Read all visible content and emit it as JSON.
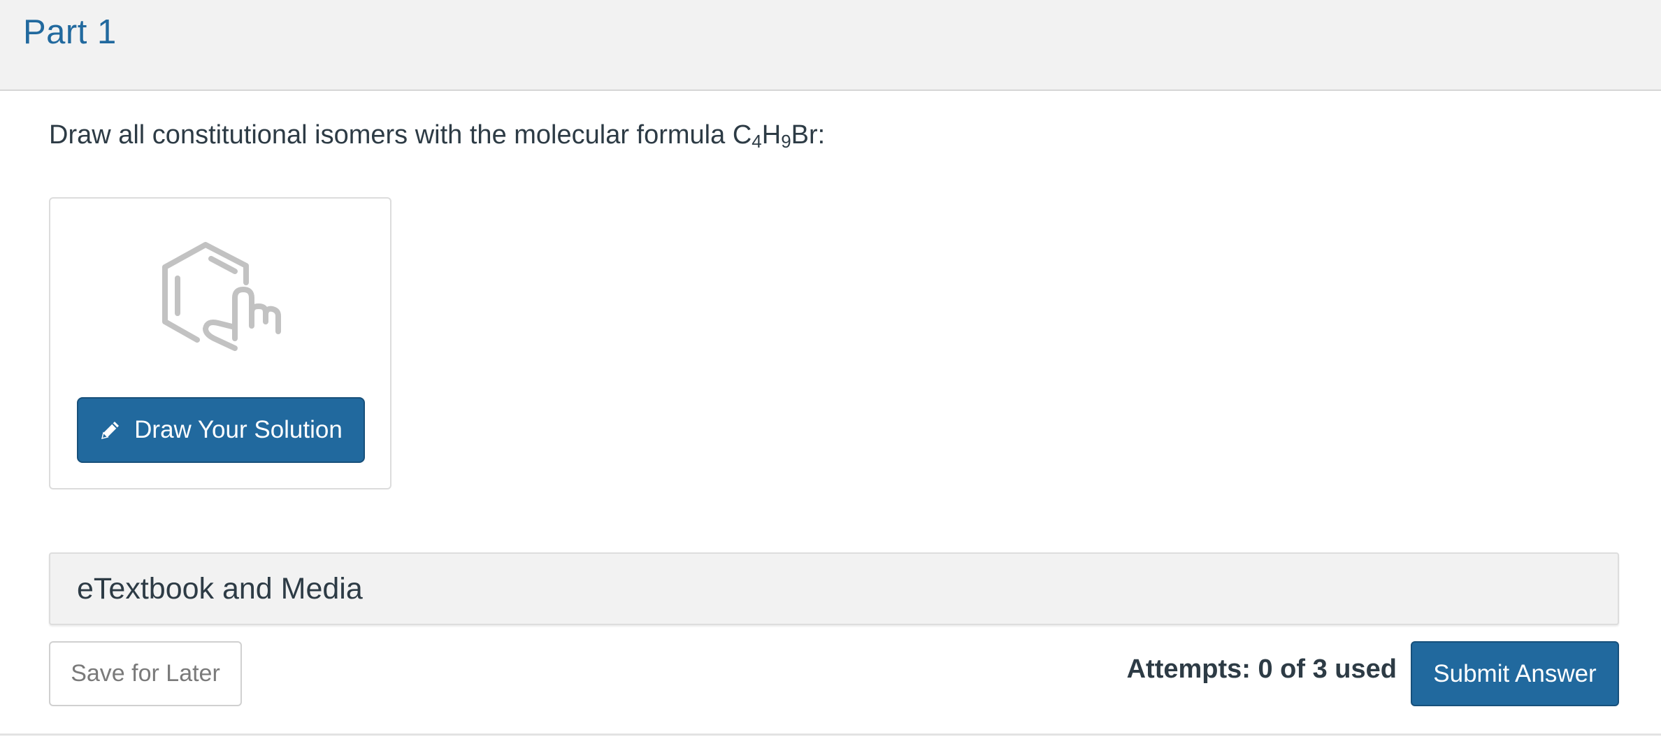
{
  "part": {
    "title": "Part 1"
  },
  "question": {
    "prefix": "Draw all constitutional isomers with the molecular formula C",
    "sub1": "4",
    "mid": "H",
    "sub2": "9",
    "suffix": "Br:"
  },
  "draw_card": {
    "icon": "molecule-touch-icon",
    "button_icon": "pencil-icon",
    "button_label": "Draw Your Solution"
  },
  "etextbook": {
    "label": "eTextbook and Media"
  },
  "footer": {
    "save_label": "Save for Later",
    "attempts_text": "Attempts: 0 of 3 used",
    "submit_label": "Submit Answer"
  },
  "colors": {
    "accent": "#21699e",
    "header_bg": "#f2f2f2",
    "icon_gray": "#c2c2c2"
  }
}
